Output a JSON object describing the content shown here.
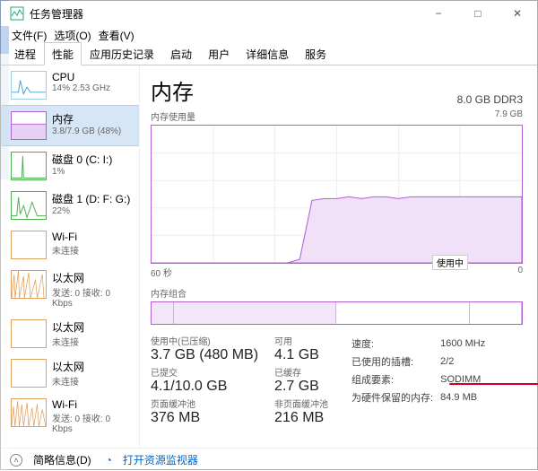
{
  "window": {
    "title": "任务管理器",
    "menu": {
      "file": "文件(F)",
      "options": "选项(O)",
      "view": "查看(V)"
    },
    "winbtns": {
      "min": "−",
      "max": "□",
      "close": "✕"
    }
  },
  "tabs": [
    "进程",
    "性能",
    "应用历史记录",
    "启动",
    "用户",
    "详细信息",
    "服务"
  ],
  "sidebar": [
    {
      "title": "CPU",
      "sub": "14% 2.53 GHz",
      "style": "blue"
    },
    {
      "title": "内存",
      "sub": "3.8/7.9 GB (48%)",
      "style": "purple"
    },
    {
      "title": "磁盘 0 (C: I:)",
      "sub": "1%",
      "style": "green"
    },
    {
      "title": "磁盘 1 (D: F: G:)",
      "sub": "22%",
      "style": "green"
    },
    {
      "title": "Wi-Fi",
      "sub": "未连接",
      "style": "orange"
    },
    {
      "title": "以太网",
      "sub": "发送: 0 接收: 0 Kbps",
      "style": "orange"
    },
    {
      "title": "以太网",
      "sub": "未连接",
      "style": "orange"
    },
    {
      "title": "以太网",
      "sub": "未连接",
      "style": "orange"
    },
    {
      "title": "Wi-Fi",
      "sub": "发送: 0 接收: 0 Kbps",
      "style": "orange"
    }
  ],
  "main": {
    "title": "内存",
    "spec": "8.0 GB DDR3",
    "chart": {
      "top_label": "内存使用量",
      "top_right": "7.9 GB",
      "bottom_left": "60 秒",
      "bottom_right": "0",
      "marker": "使用中"
    },
    "composition_label": "内存组合",
    "stats_left": {
      "row1a_lbl": "使用中(已压缩)",
      "row1a_val": "3.7 GB (480 MB)",
      "row1b_lbl": "可用",
      "row1b_val": "4.1 GB",
      "row2a_lbl": "已提交",
      "row2a_val": "4.1/10.0 GB",
      "row2b_lbl": "已缓存",
      "row2b_val": "2.7 GB",
      "row3a_lbl": "页面缓冲池",
      "row3a_val": "376 MB",
      "row3b_lbl": "非页面缓冲池",
      "row3b_val": "216 MB"
    },
    "stats_right": {
      "speed_lbl": "速度:",
      "speed_val": "1600 MHz",
      "slots_lbl": "已使用的插槽:",
      "slots_val": "2/2",
      "form_lbl": "组成要素:",
      "form_val": "SODIMM",
      "reserved_lbl": "为硬件保留的内存:",
      "reserved_val": "84.9 MB"
    }
  },
  "chart_data": {
    "type": "line",
    "title": "内存使用量",
    "xlabel": "秒",
    "ylabel": "GB",
    "xlim": [
      60,
      0
    ],
    "ylim": [
      0,
      7.9
    ],
    "x": [
      60,
      55,
      50,
      45,
      40,
      38,
      36,
      34,
      32,
      30,
      28,
      26,
      24,
      22,
      20,
      18,
      16,
      14,
      12,
      10,
      8,
      6,
      4,
      2,
      0
    ],
    "values": [
      0,
      0,
      0,
      0,
      0,
      0,
      0.2,
      3.6,
      3.7,
      3.7,
      3.8,
      3.7,
      3.8,
      3.8,
      3.7,
      3.8,
      3.8,
      3.8,
      3.8,
      3.8,
      3.8,
      3.8,
      3.8,
      3.8,
      3.8
    ]
  },
  "footer": {
    "less": "简略信息(D)",
    "link": "打开资源监视器"
  }
}
